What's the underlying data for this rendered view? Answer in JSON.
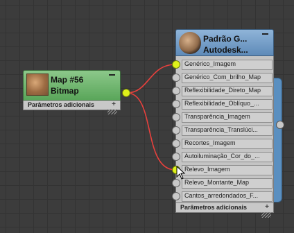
{
  "bitmap_node": {
    "title": "Map #56",
    "subtitle": "Bitmap",
    "rollout_label": "Parâmetros adicionais",
    "header_color": "#6fb46e",
    "port_active_color": "#dff21a"
  },
  "material_node": {
    "title": "Padrão G...",
    "subtitle": "Autodesk...",
    "header_color": "#7aa2cc",
    "rollout_label": "Parâmetros adicionais",
    "slots": [
      {
        "label": "Genérico_Imagem",
        "connected": true
      },
      {
        "label": "Genérico_Com_brilho_Map",
        "connected": false
      },
      {
        "label": "Reflexibilidade_Direto_Map",
        "connected": false
      },
      {
        "label": "Reflexibilidade_Oblíquo_...",
        "connected": false
      },
      {
        "label": "Transparência_Imagem",
        "connected": false
      },
      {
        "label": "Transparência_Translúci...",
        "connected": false
      },
      {
        "label": "Recortes_Imagem",
        "connected": false
      },
      {
        "label": "Autoiluminação_Cor_do_...",
        "connected": false
      },
      {
        "label": "Relevo_Imagem",
        "connected": true
      },
      {
        "label": "Relevo_Montante_Map",
        "connected": false
      },
      {
        "label": "Cantos_arredondados_F...",
        "connected": false
      }
    ]
  },
  "icons": {
    "minimize": "minimize-icon",
    "expand": "plus-icon",
    "cursor": "mouse-cursor-icon"
  },
  "wire_color": "#e8403c"
}
